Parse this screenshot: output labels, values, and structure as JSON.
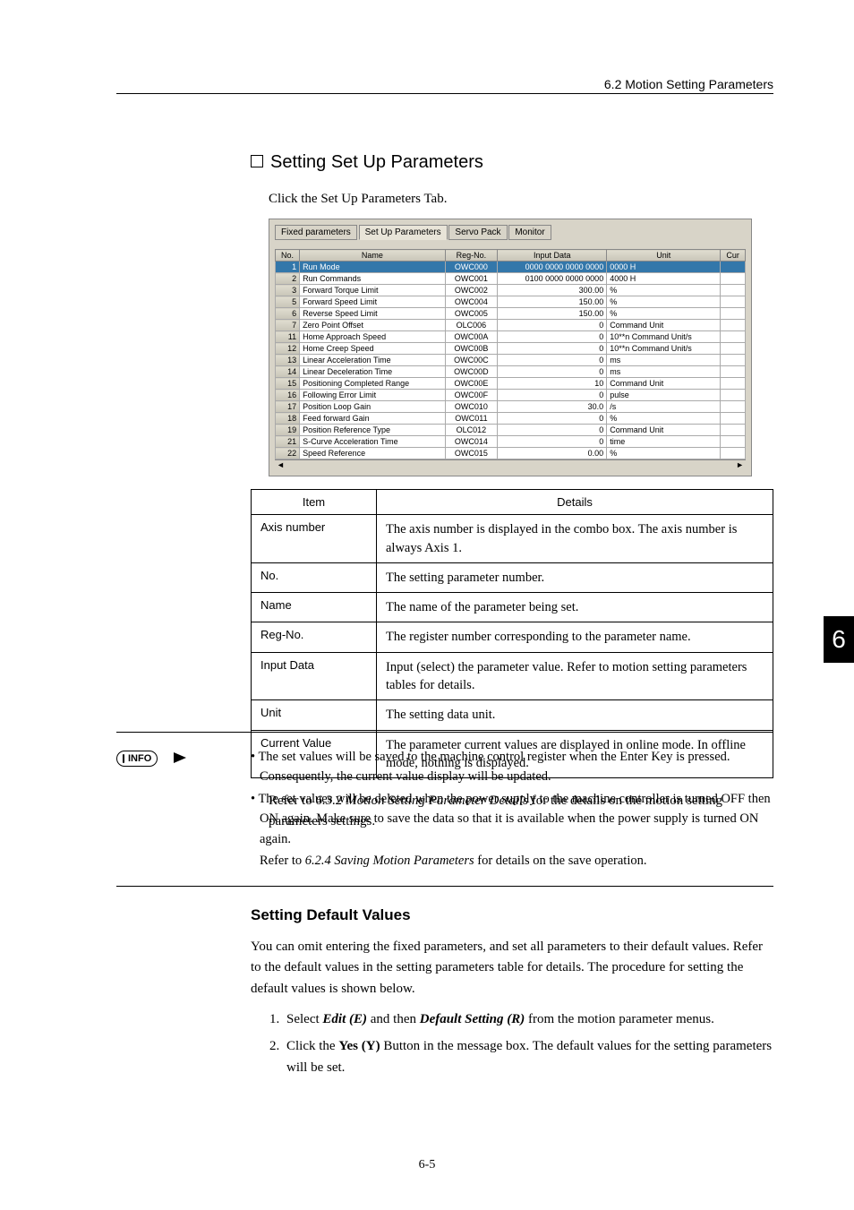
{
  "header": {
    "crumb": "6.2  Motion Setting Parameters"
  },
  "section1": {
    "title": "Setting Set Up Parameters",
    "intro": "Click the Set Up Parameters Tab."
  },
  "shot": {
    "tabs": [
      "Fixed parameters",
      "Set Up Parameters",
      "Servo Pack",
      "Monitor"
    ],
    "cols": [
      "No.",
      "Name",
      "Reg-No.",
      "Input Data",
      "Unit",
      "Cur"
    ],
    "rows": [
      {
        "no": "1",
        "name": "Run Mode",
        "reg": "OWC000",
        "data": "0000 0000 0000 0000",
        "unit": "0000 H",
        "sel": true
      },
      {
        "no": "2",
        "name": "Run Commands",
        "reg": "OWC001",
        "data": "0100 0000 0000 0000",
        "unit": "4000 H"
      },
      {
        "no": "3",
        "name": "Forward Torque Limit",
        "reg": "OWC002",
        "data": "300.00",
        "unit": "%"
      },
      {
        "no": "5",
        "name": "Forward Speed Limit",
        "reg": "OWC004",
        "data": "150.00",
        "unit": "%"
      },
      {
        "no": "6",
        "name": "Reverse Speed Limit",
        "reg": "OWC005",
        "data": "150.00",
        "unit": "%"
      },
      {
        "no": "7",
        "name": "Zero Point Offset",
        "reg": "OLC006",
        "data": "0",
        "unit": "Command Unit"
      },
      {
        "no": "11",
        "name": "Home Approach Speed",
        "reg": "OWC00A",
        "data": "0",
        "unit": "10**n Command Unit/s"
      },
      {
        "no": "12",
        "name": "Home Creep Speed",
        "reg": "OWC00B",
        "data": "0",
        "unit": "10**n Command Unit/s"
      },
      {
        "no": "13",
        "name": "Linear Acceleration Time",
        "reg": "OWC00C",
        "data": "0",
        "unit": "ms"
      },
      {
        "no": "14",
        "name": "Linear Deceleration Time",
        "reg": "OWC00D",
        "data": "0",
        "unit": "ms"
      },
      {
        "no": "15",
        "name": "Positioning Completed Range",
        "reg": "OWC00E",
        "data": "10",
        "unit": "Command Unit"
      },
      {
        "no": "16",
        "name": "Following Error Limit",
        "reg": "OWC00F",
        "data": "0",
        "unit": "pulse"
      },
      {
        "no": "17",
        "name": "Position Loop Gain",
        "reg": "OWC010",
        "data": "30.0",
        "unit": "/s"
      },
      {
        "no": "18",
        "name": "Feed forward Gain",
        "reg": "OWC011",
        "data": "0",
        "unit": "%"
      },
      {
        "no": "19",
        "name": "Position Reference Type",
        "reg": "OLC012",
        "data": "0",
        "unit": "Command Unit"
      },
      {
        "no": "21",
        "name": "S-Curve Acceleration Time",
        "reg": "OWC014",
        "data": "0",
        "unit": "time"
      },
      {
        "no": "22",
        "name": "Speed Reference",
        "reg": "OWC015",
        "data": "0.00",
        "unit": "%"
      }
    ]
  },
  "desc": {
    "headers": [
      "Item",
      "Details"
    ],
    "rows": [
      {
        "k": "Axis number",
        "v": "The axis number is displayed in the combo box. The axis number is always Axis 1."
      },
      {
        "k": "No.",
        "v": "The setting parameter number."
      },
      {
        "k": "Name",
        "v": "The name of the parameter being set."
      },
      {
        "k": "Reg-No.",
        "v": "The register number corresponding to the parameter name."
      },
      {
        "k": "Input Data",
        "v": "Input (select) the parameter value. Refer to motion setting parameters tables for details."
      },
      {
        "k": "Unit",
        "v": "The setting data unit."
      },
      {
        "k": "Current Value",
        "v": "The parameter current values are displayed in online mode. In offline mode, nothing is displayed."
      }
    ]
  },
  "refer1_pre": "Refer to ",
  "refer1_ital": "6.3.2 Motion Setting Parameter Details",
  "refer1_post": " for the details on the motion setting parameters settings.",
  "info": {
    "badge": "INFO",
    "b1": "• The set values will be saved to the machine control register when the Enter Key is pressed. Consequently, the current value display will be updated.",
    "b2": "• The set values will be deleted when the power supply to the machine controller is turned OFF then ON again. Make sure to save the data so that it is available when the power supply is turned ON again.",
    "b3_pre": "Refer to ",
    "b3_ital": "6.2.4 Saving Motion Parameters",
    "b3_post": " for details on the save operation."
  },
  "section2": {
    "title": "Setting Default Values",
    "para": "You can omit entering the fixed parameters, and set all parameters to their default values. Refer to the default values in the setting parameters table for details. The procedure for setting the default values is shown below.",
    "step1_pre": "Select ",
    "step1_b1": "Edit (E)",
    "step1_mid": " and then ",
    "step1_b2": "Default Setting (R)",
    "step1_post": " from the motion parameter menus.",
    "step2_pre": "Click the ",
    "step2_b": "Yes (Y)",
    "step2_post": " Button in the message box. The default values for the setting parameters will be set."
  },
  "sideTab": "6",
  "pageNum": "6-5"
}
